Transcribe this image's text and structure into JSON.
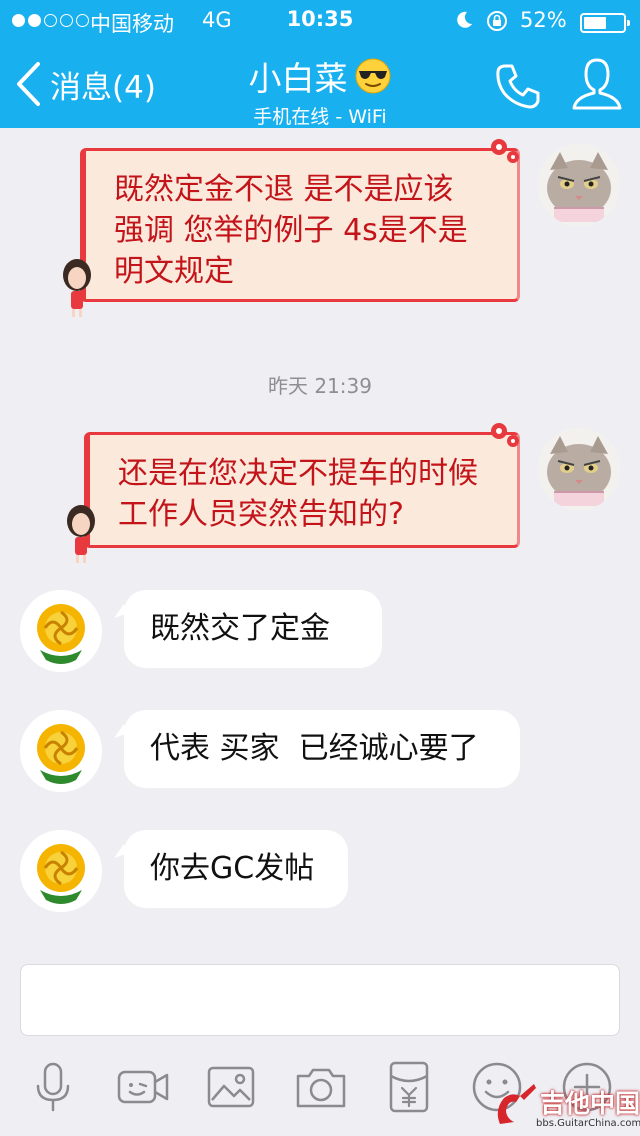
{
  "status_bar": {
    "carrier": "中国移动",
    "network": "4G",
    "time": "10:35",
    "battery": "52%"
  },
  "nav": {
    "back_label": "消息(4)",
    "title": "小白菜",
    "subtitle": "手机在线 - WiFi"
  },
  "messages": [
    {
      "side": "right",
      "style": "decorated",
      "text_lines": [
        "既然定金不退 是不是应该",
        "强调 您举的例子 4s是不是",
        "明文规定"
      ]
    },
    {
      "timestamp": "昨天 21:39"
    },
    {
      "side": "right",
      "style": "decorated",
      "text_lines": [
        "还是在您决定不提车的时候",
        "工作人员突然告知的?"
      ]
    },
    {
      "side": "left",
      "style": "plain",
      "text": "既然交了定金"
    },
    {
      "side": "left",
      "style": "plain",
      "text": "代表 买家  已经诚心要了"
    },
    {
      "side": "left",
      "style": "plain",
      "text": "你去GC发帖"
    }
  ],
  "input": {
    "placeholder": ""
  },
  "toolbar": [
    "microphone-icon",
    "video-call-icon",
    "image-icon",
    "camera-icon",
    "red-packet-icon",
    "emoji-icon",
    "plus-icon"
  ],
  "watermark": {
    "text": "吉他中国",
    "sub": "bbs.GuitarChina.com"
  },
  "colors": {
    "nav_bg": "#19b0f0",
    "chat_bg": "#eeeef3",
    "decorated_text": "#c3141a",
    "decorated_border": "#e8393e"
  }
}
